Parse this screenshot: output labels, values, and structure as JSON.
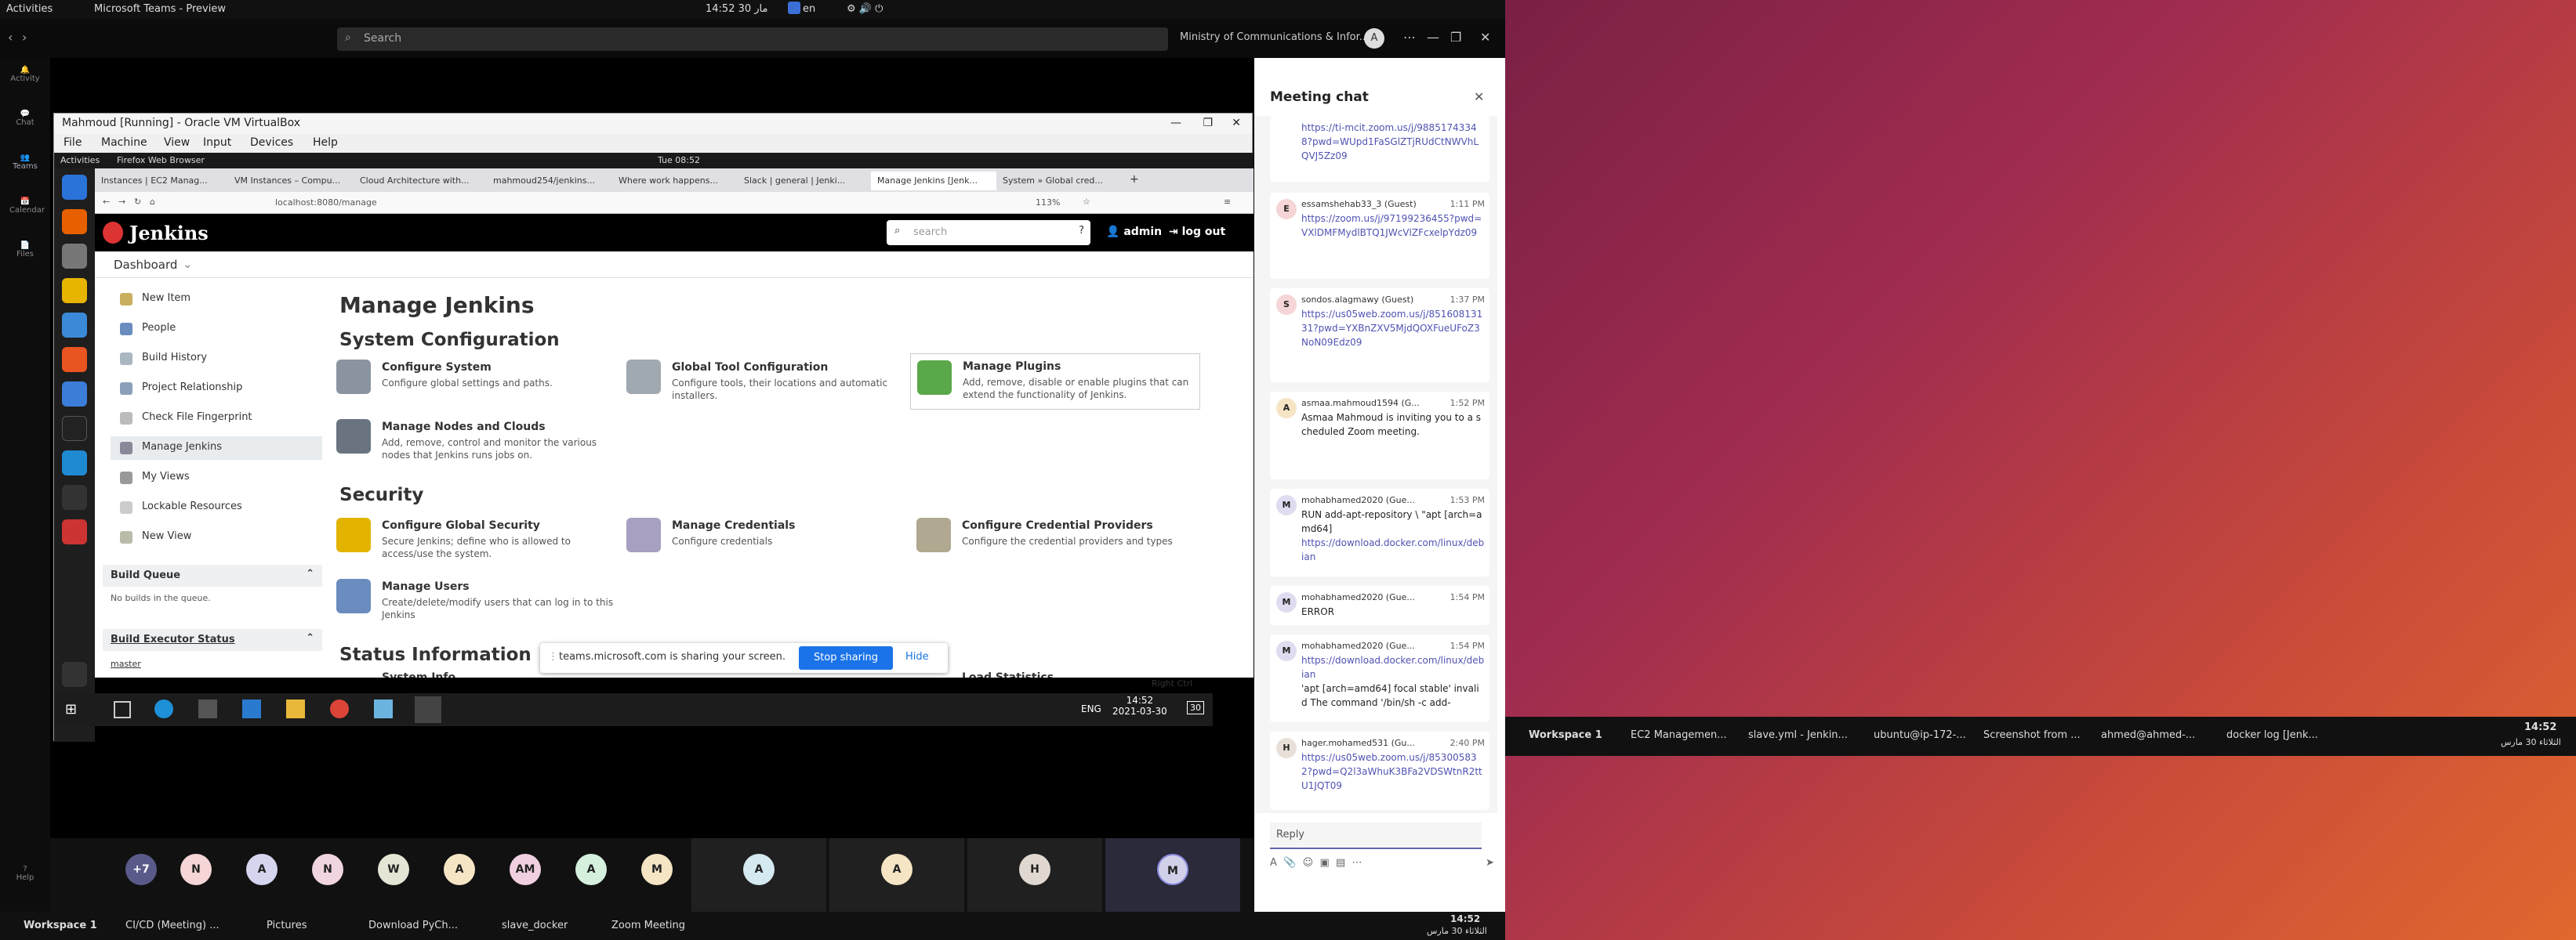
{
  "gnome": {
    "activities": "Activities",
    "app": "Microsoft Teams - Preview",
    "clock": "14:52  30 مار",
    "lang": "en"
  },
  "teams": {
    "search": "Search",
    "org": "Ministry of Communications & Infor...",
    "avatar": "A",
    "rail": [
      "Activity",
      "Chat",
      "Teams",
      "Calendar",
      "Files",
      "Help"
    ]
  },
  "vbox": {
    "title": "Mahmoud [Running] - Oracle VM VirtualBox",
    "menu": [
      "File",
      "Machine",
      "View",
      "Input",
      "Devices",
      "Help"
    ]
  },
  "guest": {
    "activities": "Activities",
    "browser": "Firefox Web Browser",
    "clock": "Tue 08:52"
  },
  "firefox": {
    "tabs": [
      "Instances | EC2 Manag...",
      "VM Instances – Compu...",
      "Cloud Architecture with...",
      "mahmoud254/jenkins...",
      "Where work happens...",
      "Slack | general | Jenki...",
      "Manage Jenkins [Jenk...",
      "System » Global cred..."
    ],
    "url": "localhost:8080/manage",
    "zoom": "113%"
  },
  "jenkins": {
    "brand": "Jenkins",
    "search_placeholder": "search",
    "user": "admin",
    "logout": "log out",
    "crumb": "Dashboard",
    "side": [
      "New Item",
      "People",
      "Build History",
      "Project Relationship",
      "Check File Fingerprint",
      "Manage Jenkins",
      "My Views",
      "Lockable Resources",
      "New View"
    ],
    "build_queue": "Build Queue",
    "queue_empty": "No builds in the queue.",
    "executor": "Build Executor Status",
    "executor_node": "master",
    "title": "Manage Jenkins",
    "sec_sys": "System Configuration",
    "sec_sec": "Security",
    "sec_status": "Status Information",
    "tiles": [
      {
        "t": "Configure System",
        "d": "Configure global settings and paths."
      },
      {
        "t": "Global Tool Configuration",
        "d": "Configure tools, their locations and automatic installers."
      },
      {
        "t": "Manage Plugins",
        "d": "Add, remove, disable or enable plugins that can extend the functionality of Jenkins."
      },
      {
        "t": "Manage Nodes and Clouds",
        "d": "Add, remove, control and monitor the various nodes that Jenkins runs jobs on."
      },
      {
        "t": "Configure Global Security",
        "d": "Secure Jenkins; define who is allowed to access/use the system."
      },
      {
        "t": "Manage Credentials",
        "d": "Configure credentials"
      },
      {
        "t": "Configure Credential Providers",
        "d": "Configure the credential providers and types"
      },
      {
        "t": "Manage Users",
        "d": "Create/delete/modify users that can log in to this Jenkins"
      },
      {
        "t": "System Info",
        "d": ""
      },
      {
        "t": "Load Statistics",
        "d": ""
      }
    ]
  },
  "share": {
    "text": "teams.microsoft.com is sharing your screen.",
    "stop": "Stop sharing",
    "hide": "Hide"
  },
  "wintask": {
    "lang": "ENG",
    "time": "14:52",
    "date": "2021-03-30",
    "rightctrl": "Right Ctrl",
    "badge": "30"
  },
  "participants": [
    "+7",
    "N",
    "A",
    "N",
    "W",
    "A",
    "AM",
    "A",
    "M",
    "A",
    "A",
    "H",
    "M"
  ],
  "chat": {
    "title": "Meeting chat",
    "reply": "Reply",
    "messages": [
      {
        "who": "",
        "time": "",
        "avatar": "",
        "txt": "",
        "lnk": "https://ti-mcit.zoom.us/j/98851743348?pwd=WUpd1FaSGlZTjRUdCtNWVhLQVJ5Zz09"
      },
      {
        "who": "essamshehab33_3 (Guest)",
        "time": "1:11 PM",
        "avatar": "E",
        "txt": "",
        "lnk": "https://zoom.us/j/97199236455?pwd=VXlDMFMydlBTQ1JWcVlZFcxelpYdz09"
      },
      {
        "who": "sondos.alagmawy (Guest)",
        "time": "1:37 PM",
        "avatar": "S",
        "txt": "",
        "lnk": "https://us05web.zoom.us/j/85160813131?pwd=YXBnZXV5MjdQOXFueUFoZ3NoN09Edz09"
      },
      {
        "who": "asmaa.mahmoud1594 (G...",
        "time": "1:52 PM",
        "avatar": "A",
        "txt": "Asmaa Mahmoud is inviting you to a scheduled Zoom meeting.",
        "lnk": ""
      },
      {
        "who": "mohabhamed2020 (Gue...",
        "time": "1:53 PM",
        "avatar": "M",
        "txt": "RUN add-apt-repository \\ \"apt [arch=amd64]",
        "lnk": "https://download.docker.com/linux/debian"
      },
      {
        "who": "mohabhamed2020 (Gue...",
        "time": "1:54 PM",
        "avatar": "M",
        "txt": "ERROR",
        "lnk": ""
      },
      {
        "who": "mohabhamed2020 (Gue...",
        "time": "1:54 PM",
        "avatar": "M",
        "txt": "'apt [arch=amd64] focal stable' invalid The command '/bin/sh -c add-",
        "lnk": "https://download.docker.com/linux/debian"
      },
      {
        "who": "hager.mohamed531 (Gu...",
        "time": "2:40 PM",
        "avatar": "H",
        "txt": "",
        "lnk": "https://us05web.zoom.us/j/853005832?pwd=Q2l3aWhuK3BFa2VDSWtnR2ttU1JQT09"
      }
    ]
  },
  "desktop": {
    "workspace": "Workspace 1",
    "tasks": [
      "EC2 Managemen...",
      "slave.yml - Jenkin...",
      "ubuntu@ip-172-...",
      "Screenshot from ...",
      "ahmed@ahmed-...",
      "docker log [Jenk..."
    ],
    "time": "14:52",
    "date": "الثلاثاء 30 مارس"
  },
  "bottom": {
    "workspace": "Workspace 1",
    "tasks": [
      "CI/CD (Meeting) ...",
      "Pictures",
      "Download PyCh...",
      "slave_docker",
      "Zoom Meeting"
    ],
    "time": "14:52",
    "date": "الثلاثاء 30 مارس"
  }
}
